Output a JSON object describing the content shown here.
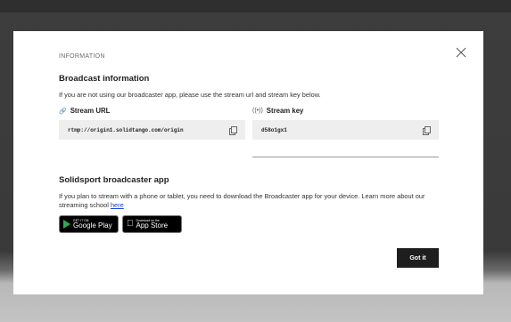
{
  "modal": {
    "eyebrow": "INFORMATION",
    "broadcast": {
      "title": "Broadcast information",
      "description": "If you are not using our broadcaster app, please use the stream url and stream key below.",
      "stream_url_label": "Stream URL",
      "stream_url_value": "rtmp://origin1.solidtango.com/origin",
      "stream_key_label": "Stream key",
      "stream_key_value": "d58o1gx1"
    },
    "app": {
      "title": "Solidsport broadcaster app",
      "description": "If you plan to stream with a phone or tablet, you need to download the Broadcaster app for your device. Learn more about our streaming school",
      "link_text": "here",
      "google_play_small": "GET IT ON",
      "google_play_big": "Google Play",
      "app_store_small": "Download on the",
      "app_store_big": "App Store"
    },
    "got_it_label": "Got it"
  },
  "icons": {
    "close": "close-icon",
    "link": "link-icon",
    "broadcast": "broadcast-icon",
    "copy": "copy-icon",
    "google_play": "google-play-icon",
    "apple": "apple-icon"
  }
}
